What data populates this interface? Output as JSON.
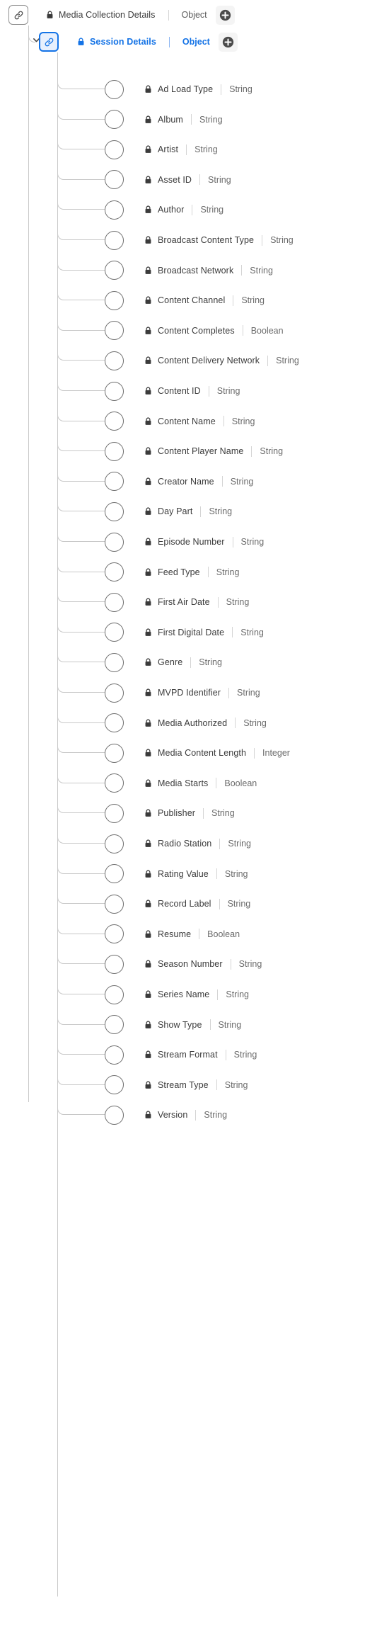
{
  "tree": {
    "root": {
      "icon": "link-icon",
      "lock_icon": "lock-icon",
      "title": "Media Collection Details",
      "type": "Object",
      "add_icon": "plus-circle-icon",
      "selected": false
    },
    "child": {
      "icon": "link-icon",
      "lock_icon": "lock-icon",
      "chevron_icon": "chevron-down-icon",
      "title": "Session Details",
      "type": "Object",
      "add_icon": "plus-circle-icon",
      "selected": true,
      "accent_color": "#1473e6"
    }
  },
  "fields": [
    {
      "lock_icon": "lock-icon",
      "name": "Ad Load Type",
      "type": "String"
    },
    {
      "lock_icon": "lock-icon",
      "name": "Album",
      "type": "String"
    },
    {
      "lock_icon": "lock-icon",
      "name": "Artist",
      "type": "String"
    },
    {
      "lock_icon": "lock-icon",
      "name": "Asset ID",
      "type": "String"
    },
    {
      "lock_icon": "lock-icon",
      "name": "Author",
      "type": "String"
    },
    {
      "lock_icon": "lock-icon",
      "name": "Broadcast Content Type",
      "type": "String"
    },
    {
      "lock_icon": "lock-icon",
      "name": "Broadcast Network",
      "type": "String"
    },
    {
      "lock_icon": "lock-icon",
      "name": "Content Channel",
      "type": "String"
    },
    {
      "lock_icon": "lock-icon",
      "name": "Content Completes",
      "type": "Boolean"
    },
    {
      "lock_icon": "lock-icon",
      "name": "Content Delivery Network",
      "type": "String"
    },
    {
      "lock_icon": "lock-icon",
      "name": "Content ID",
      "type": "String"
    },
    {
      "lock_icon": "lock-icon",
      "name": "Content Name",
      "type": "String"
    },
    {
      "lock_icon": "lock-icon",
      "name": "Content Player Name",
      "type": "String"
    },
    {
      "lock_icon": "lock-icon",
      "name": "Creator Name",
      "type": "String"
    },
    {
      "lock_icon": "lock-icon",
      "name": "Day Part",
      "type": "String"
    },
    {
      "lock_icon": "lock-icon",
      "name": "Episode Number",
      "type": "String"
    },
    {
      "lock_icon": "lock-icon",
      "name": "Feed Type",
      "type": "String"
    },
    {
      "lock_icon": "lock-icon",
      "name": "First Air Date",
      "type": "String"
    },
    {
      "lock_icon": "lock-icon",
      "name": "First Digital Date",
      "type": "String"
    },
    {
      "lock_icon": "lock-icon",
      "name": "Genre",
      "type": "String"
    },
    {
      "lock_icon": "lock-icon",
      "name": "MVPD Identifier",
      "type": "String"
    },
    {
      "lock_icon": "lock-icon",
      "name": "Media Authorized",
      "type": "String"
    },
    {
      "lock_icon": "lock-icon",
      "name": "Media Content Length",
      "type": "Integer"
    },
    {
      "lock_icon": "lock-icon",
      "name": "Media Starts",
      "type": "Boolean"
    },
    {
      "lock_icon": "lock-icon",
      "name": "Publisher",
      "type": "String"
    },
    {
      "lock_icon": "lock-icon",
      "name": "Radio Station",
      "type": "String"
    },
    {
      "lock_icon": "lock-icon",
      "name": "Rating Value",
      "type": "String"
    },
    {
      "lock_icon": "lock-icon",
      "name": "Record Label",
      "type": "String"
    },
    {
      "lock_icon": "lock-icon",
      "name": "Resume",
      "type": "Boolean"
    },
    {
      "lock_icon": "lock-icon",
      "name": "Season Number",
      "type": "String"
    },
    {
      "lock_icon": "lock-icon",
      "name": "Series Name",
      "type": "String"
    },
    {
      "lock_icon": "lock-icon",
      "name": "Show Type",
      "type": "String"
    },
    {
      "lock_icon": "lock-icon",
      "name": "Stream Format",
      "type": "String"
    },
    {
      "lock_icon": "lock-icon",
      "name": "Stream Type",
      "type": "String"
    },
    {
      "lock_icon": "lock-icon",
      "name": "Version",
      "type": "String"
    }
  ]
}
